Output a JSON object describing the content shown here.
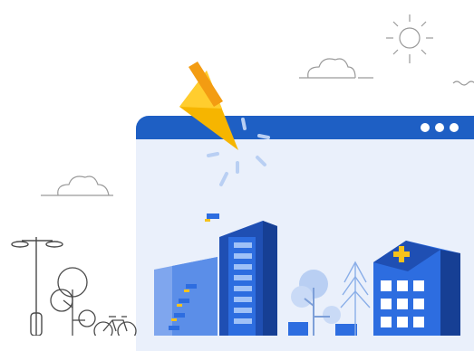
{
  "scene": {
    "description_free": true,
    "window": {
      "titlebar_color": "#1e5fc4",
      "body_color": "#eaf0fb",
      "dots": 3
    },
    "colors": {
      "building_dark": "#1f4fb3",
      "building_mid": "#2d6de0",
      "building_light": "#5b8ee8",
      "window_light": "#9fc1f7",
      "cursor_yellow": "#f6b500",
      "cursor_orange": "#f39c12",
      "flag_yellow": "#f5c21b",
      "tree_light": "#b9cff3",
      "outline": "#4a4a4a"
    },
    "icons": [
      "pointer-cursor-icon",
      "sun-icon",
      "cloud-icon",
      "bicycle-icon",
      "street-lamp-icon",
      "hospital-cross-icon"
    ]
  }
}
